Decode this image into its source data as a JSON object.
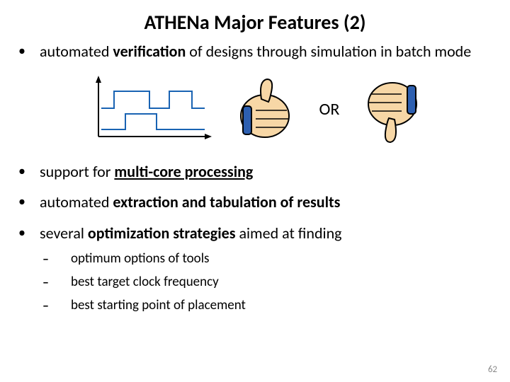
{
  "title": "ATHENa Major Features (2)",
  "bullets": {
    "b1_prefix": "automated ",
    "b1_strong": "verification",
    "b1_suffix": " of designs through simulation in batch mode",
    "b2_prefix": "support for ",
    "b2_strong": "multi-core processing",
    "b3_prefix": "automated ",
    "b3_strong": "extraction and tabulation of results",
    "b4_prefix": "several ",
    "b4_strong": "optimization strategies",
    "b4_suffix": " aimed at finding"
  },
  "subitems": {
    "s1": "optimum options of tools",
    "s2": "best target clock frequency",
    "s3": "best starting point of placement"
  },
  "or_label": "OR",
  "page_number": "62",
  "icons": {
    "waveform": "waveform-icon",
    "thumbs_up": "thumbs-up-icon",
    "thumbs_down": "thumbs-down-icon"
  }
}
